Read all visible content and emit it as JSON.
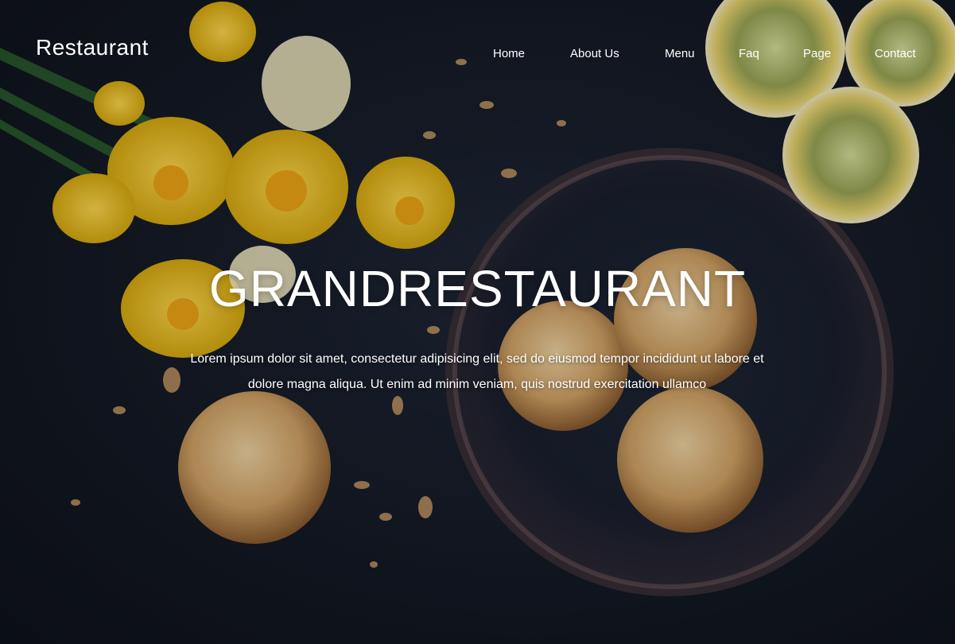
{
  "site": {
    "brand": "Restaurant"
  },
  "nav": {
    "items": [
      {
        "label": "Home"
      },
      {
        "label": "About Us"
      },
      {
        "label": "Menu"
      },
      {
        "label": "Faq"
      },
      {
        "label": "Page"
      },
      {
        "label": "Contact"
      }
    ]
  },
  "hero": {
    "headline": "GRANDRESTAURANT",
    "description": "Lorem ipsum dolor sit amet, consectetur adipisicing elit, sed do eiusmod tempor incididunt ut labore et dolore magna aliqua. Ut enim ad minim veniam, quis nostrud exercitation ullamco",
    "background_image": "dark-table-with-daffodils-almond-cookies-and-lemon-slices"
  },
  "colors": {
    "text": "#ffffff",
    "background": "#121620",
    "daffodil_yellow": "#f2c21b",
    "cookie": "#d9a86a",
    "lemon": "#e9d77a"
  }
}
